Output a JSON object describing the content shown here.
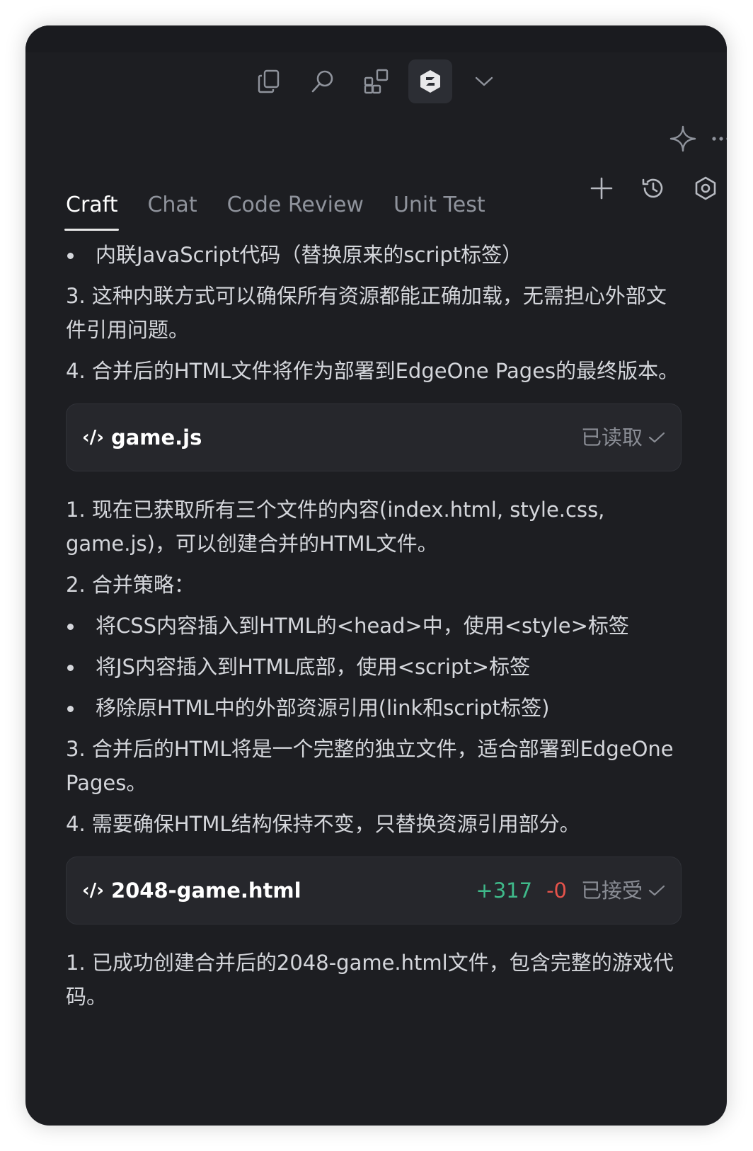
{
  "tabs": [
    {
      "label": "Craft",
      "active": true
    },
    {
      "label": "Chat",
      "active": false
    },
    {
      "label": "Code Review",
      "active": false
    },
    {
      "label": "Unit Test",
      "active": false
    }
  ],
  "toolbar": {
    "icons": [
      "copy-icon",
      "search-icon",
      "extensions-icon",
      "app-logo-icon",
      "chevron-down-icon"
    ]
  },
  "messages": {
    "block1": {
      "bullet": "内联JavaScript代码（替换原来的script标签）",
      "item3": "3. 这种内联方式可以确保所有资源都能正确加载，无需担心外部文件引用问题。",
      "item4": "4. 合并后的HTML文件将作为部署到EdgeOne Pages的最终版本。"
    },
    "card1": {
      "code_icon": "‹/›",
      "filename": "game.js",
      "status": "已读取"
    },
    "block2": {
      "item1": "1. 现在已获取所有三个文件的内容(index.html, style.css, game.js)，可以创建合并的HTML文件。",
      "item2": "2. 合并策略：",
      "bullet1": "将CSS内容插入到HTML的<head>中，使用<style>标签",
      "bullet2": "将JS内容插入到HTML底部，使用<script>标签",
      "bullet3": "移除原HTML中的外部资源引用(link和script标签)",
      "item3": "3. 合并后的HTML将是一个完整的独立文件，适合部署到EdgeOne Pages。",
      "item4": "4. 需要确保HTML结构保持不变，只替换资源引用部分。"
    },
    "card2": {
      "code_icon": "‹/›",
      "filename": "2048-game.html",
      "added": "+317",
      "removed": "-0",
      "status": "已接受"
    },
    "block3": {
      "item1": "1. 已成功创建合并后的2048-game.html文件，包含完整的游戏代码。"
    }
  },
  "colors": {
    "background": "#1d1e22",
    "card": "#26272c",
    "added": "#3fb98a",
    "removed": "#e5534b",
    "text": "#d4d6db"
  }
}
